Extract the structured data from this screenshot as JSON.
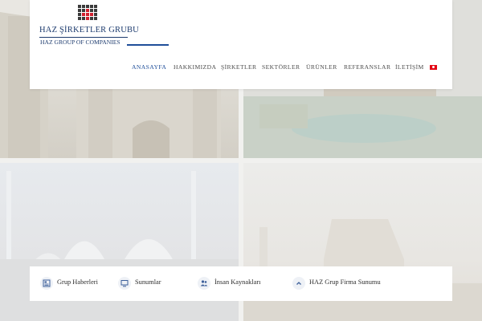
{
  "brand": {
    "title": "HAZ ŞİRKETLER GRUBU",
    "subtitle": "HAZ GROUP OF COMPANIES",
    "color": "#1d3b6e"
  },
  "nav": {
    "items": [
      {
        "label": "ANASAYFA",
        "active": true
      },
      {
        "label": "HAKKIMIZDA",
        "active": false
      },
      {
        "label": "ŞİRKETLER",
        "active": false
      },
      {
        "label": "SEKTÖRLER",
        "active": false
      },
      {
        "label": "ÜRÜNLER",
        "active": false
      },
      {
        "label": "REFERANSLAR",
        "active": false
      },
      {
        "label": "İLETİŞİM",
        "active": false
      }
    ],
    "language_flag": "turkey-flag-icon",
    "active_color": "#1f4e9a"
  },
  "quick_links": [
    {
      "label": "Grup Haberleri",
      "icon": "news-icon"
    },
    {
      "label": "Sunumlar",
      "icon": "monitor-icon"
    },
    {
      "label": "İnsan Kaynakları",
      "icon": "users-icon"
    },
    {
      "label": "HAZ Grup Firma Sunumu",
      "icon": "chevron-up-icon"
    }
  ]
}
